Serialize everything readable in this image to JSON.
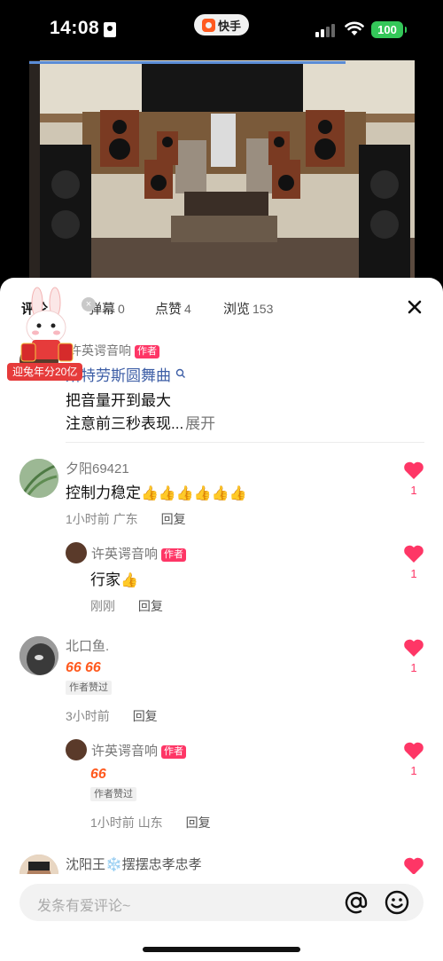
{
  "status_bar": {
    "time": "14:08",
    "app_name": "快手",
    "battery": "100"
  },
  "colors": {
    "accent": "#fe3666",
    "link": "#3d5ea6",
    "battery": "#34c759",
    "video_progress": "#5a8cd6"
  },
  "video": {
    "progress_fraction": 0.82
  },
  "tabs": [
    {
      "label": "评论"
    },
    {
      "label": "弹幕",
      "count": "0"
    },
    {
      "label": "点赞",
      "count": "4"
    },
    {
      "label": "浏览",
      "count": "153"
    }
  ],
  "promo": {
    "badge": "迎兔年分20亿"
  },
  "author_post": {
    "name": "许英谔音响",
    "tag": "作者",
    "song": "斯特劳斯圆舞曲",
    "line1": "把音量开到最大",
    "line2": "注意前三秒表现...",
    "expand": "展开"
  },
  "comments": [
    {
      "user": "夕阳69421",
      "text": "控制力稳定",
      "emoji": "👍👍👍👍👍👍",
      "time": "1小时前",
      "location": "广东",
      "reply_label": "回复",
      "likes": "1",
      "replies": [
        {
          "user": "许英谔音响",
          "tag": "作者",
          "text": "行家",
          "emoji": "👍",
          "time": "刚刚",
          "reply_label": "回复",
          "likes": "1"
        }
      ]
    },
    {
      "user": "北口鱼.",
      "liked_tag": "作者赞过",
      "time": "3小时前",
      "reply_label": "回复",
      "likes": "1",
      "replies": [
        {
          "user": "许英谔音响",
          "tag": "作者",
          "liked_tag": "作者赞过",
          "time": "1小时前",
          "location": "山东",
          "reply_label": "回复",
          "likes": "1"
        }
      ]
    },
    {
      "user": "沈阳王❄️摆摆忠孝忠孝"
    }
  ],
  "input": {
    "placeholder": "发条有爱评论~"
  }
}
